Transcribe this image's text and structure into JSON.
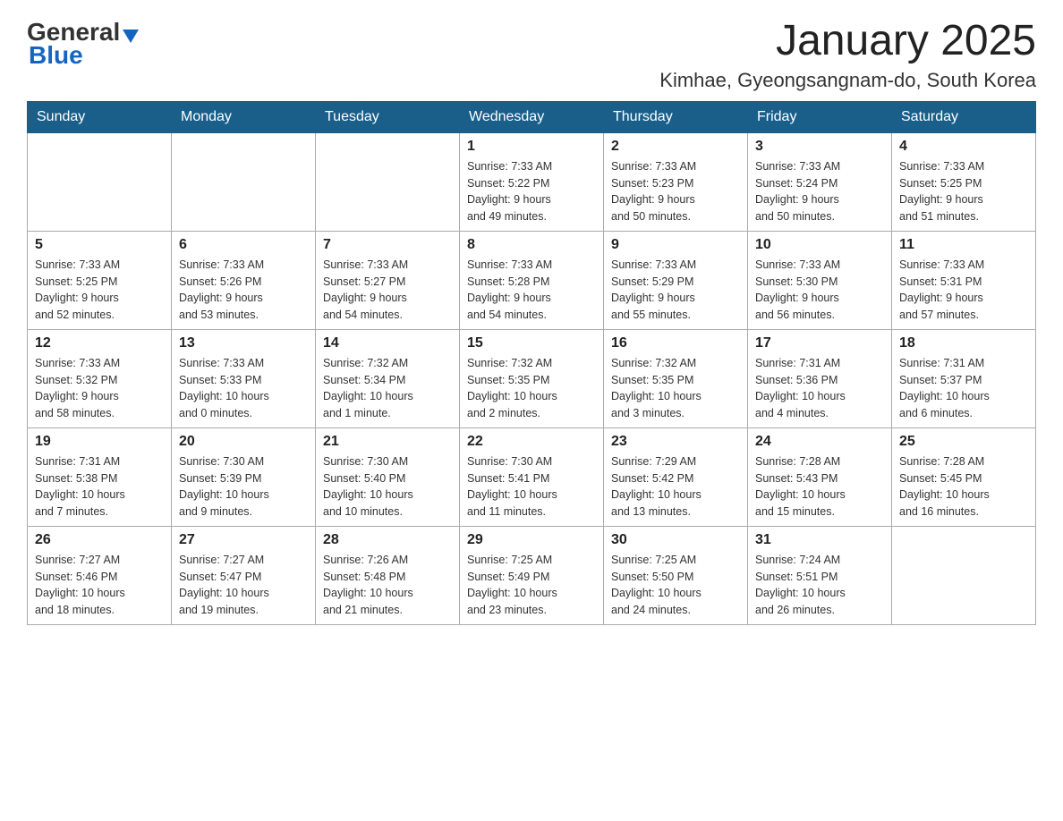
{
  "header": {
    "logo": {
      "general": "General",
      "triangle_symbol": "▲",
      "blue": "Blue"
    },
    "title": "January 2025",
    "location": "Kimhae, Gyeongsangnam-do, South Korea"
  },
  "days_of_week": [
    "Sunday",
    "Monday",
    "Tuesday",
    "Wednesday",
    "Thursday",
    "Friday",
    "Saturday"
  ],
  "weeks": [
    [
      {
        "day": "",
        "info": ""
      },
      {
        "day": "",
        "info": ""
      },
      {
        "day": "",
        "info": ""
      },
      {
        "day": "1",
        "info": "Sunrise: 7:33 AM\nSunset: 5:22 PM\nDaylight: 9 hours\nand 49 minutes."
      },
      {
        "day": "2",
        "info": "Sunrise: 7:33 AM\nSunset: 5:23 PM\nDaylight: 9 hours\nand 50 minutes."
      },
      {
        "day": "3",
        "info": "Sunrise: 7:33 AM\nSunset: 5:24 PM\nDaylight: 9 hours\nand 50 minutes."
      },
      {
        "day": "4",
        "info": "Sunrise: 7:33 AM\nSunset: 5:25 PM\nDaylight: 9 hours\nand 51 minutes."
      }
    ],
    [
      {
        "day": "5",
        "info": "Sunrise: 7:33 AM\nSunset: 5:25 PM\nDaylight: 9 hours\nand 52 minutes."
      },
      {
        "day": "6",
        "info": "Sunrise: 7:33 AM\nSunset: 5:26 PM\nDaylight: 9 hours\nand 53 minutes."
      },
      {
        "day": "7",
        "info": "Sunrise: 7:33 AM\nSunset: 5:27 PM\nDaylight: 9 hours\nand 54 minutes."
      },
      {
        "day": "8",
        "info": "Sunrise: 7:33 AM\nSunset: 5:28 PM\nDaylight: 9 hours\nand 54 minutes."
      },
      {
        "day": "9",
        "info": "Sunrise: 7:33 AM\nSunset: 5:29 PM\nDaylight: 9 hours\nand 55 minutes."
      },
      {
        "day": "10",
        "info": "Sunrise: 7:33 AM\nSunset: 5:30 PM\nDaylight: 9 hours\nand 56 minutes."
      },
      {
        "day": "11",
        "info": "Sunrise: 7:33 AM\nSunset: 5:31 PM\nDaylight: 9 hours\nand 57 minutes."
      }
    ],
    [
      {
        "day": "12",
        "info": "Sunrise: 7:33 AM\nSunset: 5:32 PM\nDaylight: 9 hours\nand 58 minutes."
      },
      {
        "day": "13",
        "info": "Sunrise: 7:33 AM\nSunset: 5:33 PM\nDaylight: 10 hours\nand 0 minutes."
      },
      {
        "day": "14",
        "info": "Sunrise: 7:32 AM\nSunset: 5:34 PM\nDaylight: 10 hours\nand 1 minute."
      },
      {
        "day": "15",
        "info": "Sunrise: 7:32 AM\nSunset: 5:35 PM\nDaylight: 10 hours\nand 2 minutes."
      },
      {
        "day": "16",
        "info": "Sunrise: 7:32 AM\nSunset: 5:35 PM\nDaylight: 10 hours\nand 3 minutes."
      },
      {
        "day": "17",
        "info": "Sunrise: 7:31 AM\nSunset: 5:36 PM\nDaylight: 10 hours\nand 4 minutes."
      },
      {
        "day": "18",
        "info": "Sunrise: 7:31 AM\nSunset: 5:37 PM\nDaylight: 10 hours\nand 6 minutes."
      }
    ],
    [
      {
        "day": "19",
        "info": "Sunrise: 7:31 AM\nSunset: 5:38 PM\nDaylight: 10 hours\nand 7 minutes."
      },
      {
        "day": "20",
        "info": "Sunrise: 7:30 AM\nSunset: 5:39 PM\nDaylight: 10 hours\nand 9 minutes."
      },
      {
        "day": "21",
        "info": "Sunrise: 7:30 AM\nSunset: 5:40 PM\nDaylight: 10 hours\nand 10 minutes."
      },
      {
        "day": "22",
        "info": "Sunrise: 7:30 AM\nSunset: 5:41 PM\nDaylight: 10 hours\nand 11 minutes."
      },
      {
        "day": "23",
        "info": "Sunrise: 7:29 AM\nSunset: 5:42 PM\nDaylight: 10 hours\nand 13 minutes."
      },
      {
        "day": "24",
        "info": "Sunrise: 7:28 AM\nSunset: 5:43 PM\nDaylight: 10 hours\nand 15 minutes."
      },
      {
        "day": "25",
        "info": "Sunrise: 7:28 AM\nSunset: 5:45 PM\nDaylight: 10 hours\nand 16 minutes."
      }
    ],
    [
      {
        "day": "26",
        "info": "Sunrise: 7:27 AM\nSunset: 5:46 PM\nDaylight: 10 hours\nand 18 minutes."
      },
      {
        "day": "27",
        "info": "Sunrise: 7:27 AM\nSunset: 5:47 PM\nDaylight: 10 hours\nand 19 minutes."
      },
      {
        "day": "28",
        "info": "Sunrise: 7:26 AM\nSunset: 5:48 PM\nDaylight: 10 hours\nand 21 minutes."
      },
      {
        "day": "29",
        "info": "Sunrise: 7:25 AM\nSunset: 5:49 PM\nDaylight: 10 hours\nand 23 minutes."
      },
      {
        "day": "30",
        "info": "Sunrise: 7:25 AM\nSunset: 5:50 PM\nDaylight: 10 hours\nand 24 minutes."
      },
      {
        "day": "31",
        "info": "Sunrise: 7:24 AM\nSunset: 5:51 PM\nDaylight: 10 hours\nand 26 minutes."
      },
      {
        "day": "",
        "info": ""
      }
    ]
  ]
}
